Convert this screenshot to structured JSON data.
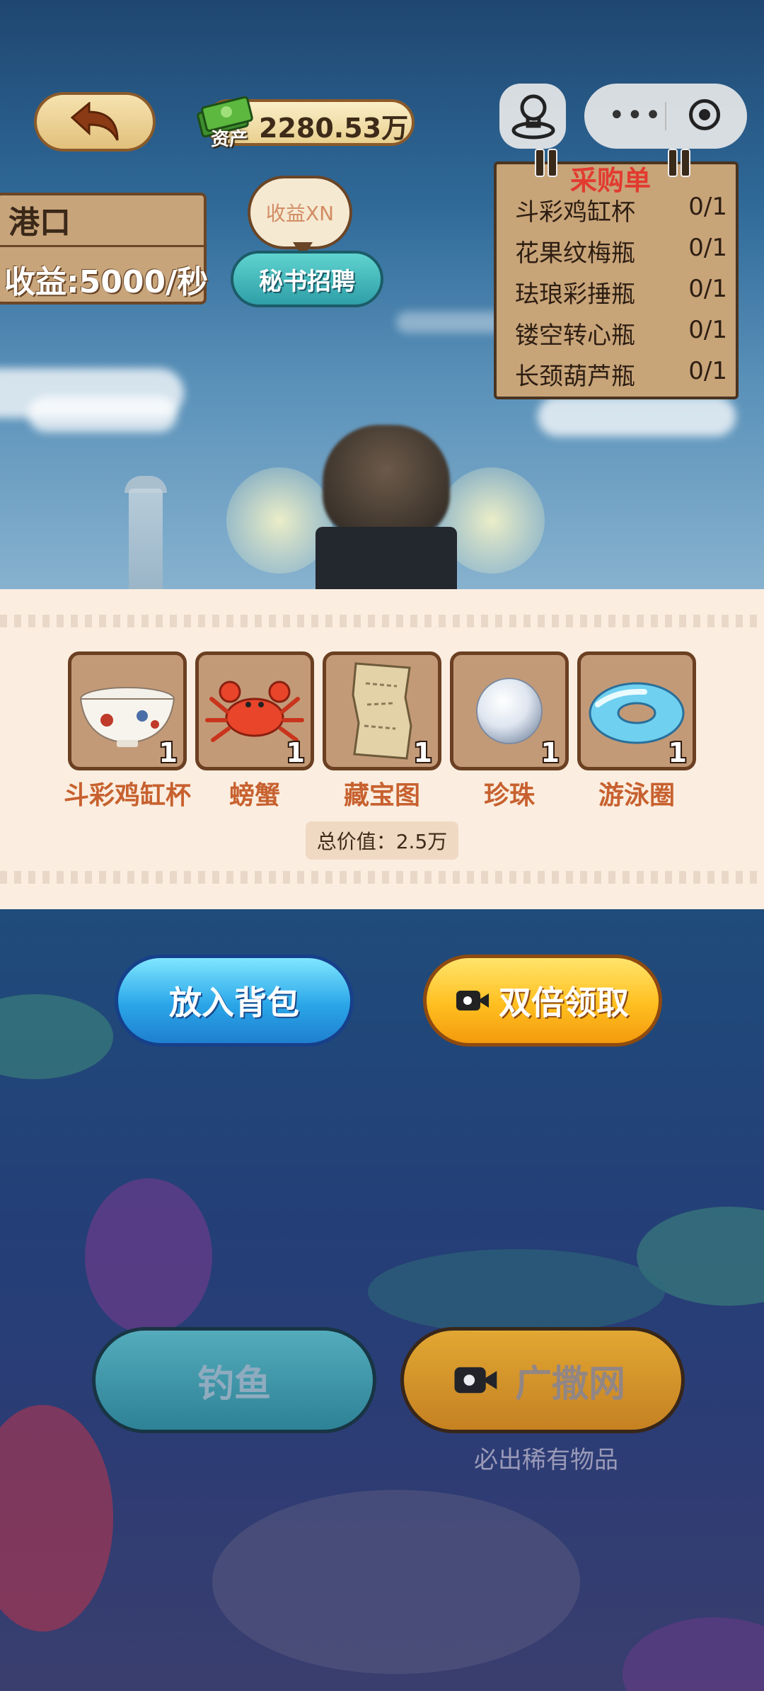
{
  "header": {
    "assets_value": "2280.53万",
    "assets_label": "资产"
  },
  "port": {
    "title": "港口",
    "income": "收益:5000/秒"
  },
  "bubble": {
    "text": "收益XN"
  },
  "recruit": {
    "label": "秘书招聘"
  },
  "purchase_list": {
    "title": "采购单",
    "rows": [
      {
        "name": "斗彩鸡缸杯",
        "progress": "0/1"
      },
      {
        "name": "花果纹梅瓶",
        "progress": "0/1"
      },
      {
        "name": "珐琅彩捶瓶",
        "progress": "0/1"
      },
      {
        "name": "镂空转心瓶",
        "progress": "0/1"
      },
      {
        "name": "长颈葫芦瓶",
        "progress": "0/1"
      }
    ]
  },
  "catch": {
    "items": [
      {
        "name": "斗彩鸡缸杯",
        "count": "1",
        "icon": "porcelain-bowl-icon"
      },
      {
        "name": "螃蟹",
        "count": "1",
        "icon": "crab-icon"
      },
      {
        "name": "藏宝图",
        "count": "1",
        "icon": "treasure-map-icon"
      },
      {
        "name": "珍珠",
        "count": "1",
        "icon": "pearl-icon"
      },
      {
        "name": "游泳圈",
        "count": "1",
        "icon": "swim-ring-icon"
      }
    ],
    "total_label": "总价值：",
    "total_value": "2.5万"
  },
  "actions": {
    "put_bag": "放入背包",
    "double": "双倍领取",
    "fish": "钓鱼",
    "net": "广撒网",
    "net_sub": "必出稀有物品"
  },
  "colors": {
    "accent_red": "#e23b30",
    "item_name": "#c7612f",
    "blue_button": "#2aa6e8",
    "gold_button": "#ffbf1f"
  }
}
